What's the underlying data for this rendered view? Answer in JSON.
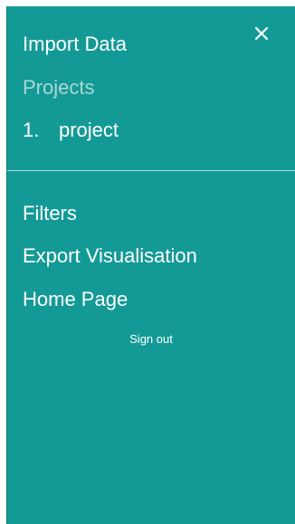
{
  "drawer": {
    "close_icon": "close-icon",
    "import_label": "Import Data",
    "projects_heading": "Projects",
    "projects": [
      {
        "number": "1.",
        "name": "project"
      }
    ],
    "filters_label": "Filters",
    "export_label": "Export Visualisation",
    "home_label": "Home Page",
    "signout_label": "Sign out"
  },
  "colors": {
    "drawer_background": "#149a96",
    "text": "#ffffff",
    "muted_text": "#a9d8d6",
    "divider": "#a7d9d6"
  }
}
